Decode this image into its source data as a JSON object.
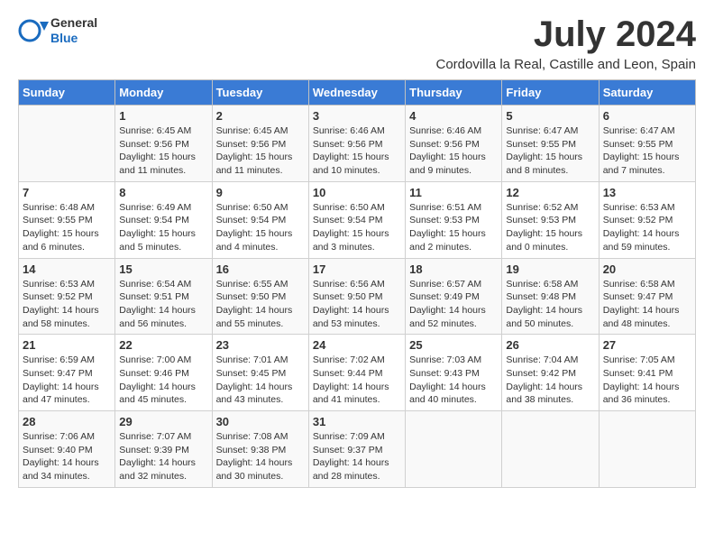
{
  "header": {
    "logo_line1": "General",
    "logo_line2": "Blue",
    "title": "July 2024",
    "location": "Cordovilla la Real, Castille and Leon, Spain"
  },
  "weekdays": [
    "Sunday",
    "Monday",
    "Tuesday",
    "Wednesday",
    "Thursday",
    "Friday",
    "Saturday"
  ],
  "weeks": [
    [
      {
        "day": "",
        "details": ""
      },
      {
        "day": "1",
        "details": "Sunrise: 6:45 AM\nSunset: 9:56 PM\nDaylight: 15 hours\nand 11 minutes."
      },
      {
        "day": "2",
        "details": "Sunrise: 6:45 AM\nSunset: 9:56 PM\nDaylight: 15 hours\nand 11 minutes."
      },
      {
        "day": "3",
        "details": "Sunrise: 6:46 AM\nSunset: 9:56 PM\nDaylight: 15 hours\nand 10 minutes."
      },
      {
        "day": "4",
        "details": "Sunrise: 6:46 AM\nSunset: 9:56 PM\nDaylight: 15 hours\nand 9 minutes."
      },
      {
        "day": "5",
        "details": "Sunrise: 6:47 AM\nSunset: 9:55 PM\nDaylight: 15 hours\nand 8 minutes."
      },
      {
        "day": "6",
        "details": "Sunrise: 6:47 AM\nSunset: 9:55 PM\nDaylight: 15 hours\nand 7 minutes."
      }
    ],
    [
      {
        "day": "7",
        "details": "Sunrise: 6:48 AM\nSunset: 9:55 PM\nDaylight: 15 hours\nand 6 minutes."
      },
      {
        "day": "8",
        "details": "Sunrise: 6:49 AM\nSunset: 9:54 PM\nDaylight: 15 hours\nand 5 minutes."
      },
      {
        "day": "9",
        "details": "Sunrise: 6:50 AM\nSunset: 9:54 PM\nDaylight: 15 hours\nand 4 minutes."
      },
      {
        "day": "10",
        "details": "Sunrise: 6:50 AM\nSunset: 9:54 PM\nDaylight: 15 hours\nand 3 minutes."
      },
      {
        "day": "11",
        "details": "Sunrise: 6:51 AM\nSunset: 9:53 PM\nDaylight: 15 hours\nand 2 minutes."
      },
      {
        "day": "12",
        "details": "Sunrise: 6:52 AM\nSunset: 9:53 PM\nDaylight: 15 hours\nand 0 minutes."
      },
      {
        "day": "13",
        "details": "Sunrise: 6:53 AM\nSunset: 9:52 PM\nDaylight: 14 hours\nand 59 minutes."
      }
    ],
    [
      {
        "day": "14",
        "details": "Sunrise: 6:53 AM\nSunset: 9:52 PM\nDaylight: 14 hours\nand 58 minutes."
      },
      {
        "day": "15",
        "details": "Sunrise: 6:54 AM\nSunset: 9:51 PM\nDaylight: 14 hours\nand 56 minutes."
      },
      {
        "day": "16",
        "details": "Sunrise: 6:55 AM\nSunset: 9:50 PM\nDaylight: 14 hours\nand 55 minutes."
      },
      {
        "day": "17",
        "details": "Sunrise: 6:56 AM\nSunset: 9:50 PM\nDaylight: 14 hours\nand 53 minutes."
      },
      {
        "day": "18",
        "details": "Sunrise: 6:57 AM\nSunset: 9:49 PM\nDaylight: 14 hours\nand 52 minutes."
      },
      {
        "day": "19",
        "details": "Sunrise: 6:58 AM\nSunset: 9:48 PM\nDaylight: 14 hours\nand 50 minutes."
      },
      {
        "day": "20",
        "details": "Sunrise: 6:58 AM\nSunset: 9:47 PM\nDaylight: 14 hours\nand 48 minutes."
      }
    ],
    [
      {
        "day": "21",
        "details": "Sunrise: 6:59 AM\nSunset: 9:47 PM\nDaylight: 14 hours\nand 47 minutes."
      },
      {
        "day": "22",
        "details": "Sunrise: 7:00 AM\nSunset: 9:46 PM\nDaylight: 14 hours\nand 45 minutes."
      },
      {
        "day": "23",
        "details": "Sunrise: 7:01 AM\nSunset: 9:45 PM\nDaylight: 14 hours\nand 43 minutes."
      },
      {
        "day": "24",
        "details": "Sunrise: 7:02 AM\nSunset: 9:44 PM\nDaylight: 14 hours\nand 41 minutes."
      },
      {
        "day": "25",
        "details": "Sunrise: 7:03 AM\nSunset: 9:43 PM\nDaylight: 14 hours\nand 40 minutes."
      },
      {
        "day": "26",
        "details": "Sunrise: 7:04 AM\nSunset: 9:42 PM\nDaylight: 14 hours\nand 38 minutes."
      },
      {
        "day": "27",
        "details": "Sunrise: 7:05 AM\nSunset: 9:41 PM\nDaylight: 14 hours\nand 36 minutes."
      }
    ],
    [
      {
        "day": "28",
        "details": "Sunrise: 7:06 AM\nSunset: 9:40 PM\nDaylight: 14 hours\nand 34 minutes."
      },
      {
        "day": "29",
        "details": "Sunrise: 7:07 AM\nSunset: 9:39 PM\nDaylight: 14 hours\nand 32 minutes."
      },
      {
        "day": "30",
        "details": "Sunrise: 7:08 AM\nSunset: 9:38 PM\nDaylight: 14 hours\nand 30 minutes."
      },
      {
        "day": "31",
        "details": "Sunrise: 7:09 AM\nSunset: 9:37 PM\nDaylight: 14 hours\nand 28 minutes."
      },
      {
        "day": "",
        "details": ""
      },
      {
        "day": "",
        "details": ""
      },
      {
        "day": "",
        "details": ""
      }
    ]
  ]
}
